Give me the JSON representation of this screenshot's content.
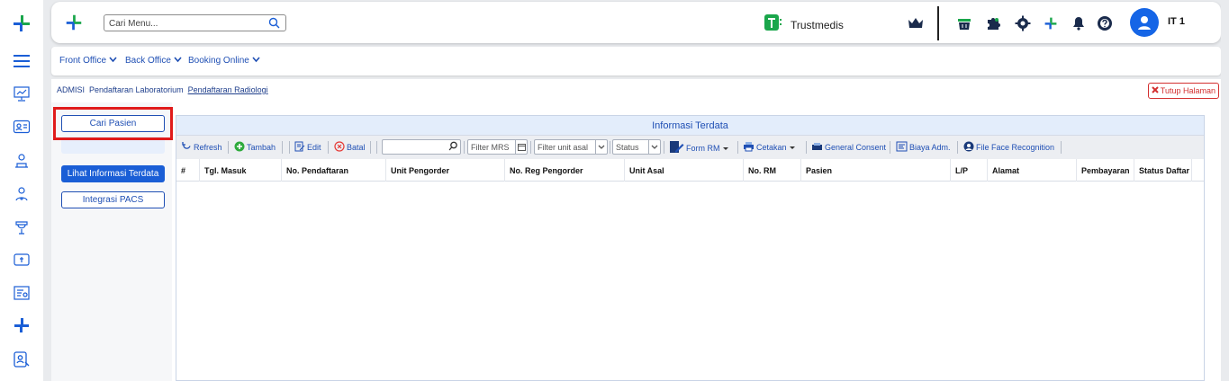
{
  "header": {
    "search_placeholder": "Cari Menu...",
    "brand_name": "Trustmedis",
    "user_name": "IT 1"
  },
  "menubar": {
    "items": [
      {
        "label": "Front Office"
      },
      {
        "label": "Back Office"
      },
      {
        "label": "Booking Online"
      }
    ]
  },
  "breadcrumb": {
    "items": [
      "ADMISI",
      "Pendaftaran Laboratorium",
      "Pendaftaran Radiologi"
    ]
  },
  "close_page_label": "Tutup Halaman",
  "left_panel": {
    "btn_search_patient": "Cari Pasien",
    "btn_view_registered": "Lihat Informasi Terdata",
    "btn_pacs": "Integrasi PACS"
  },
  "grid": {
    "title": "Informasi Terdata",
    "toolbar": {
      "refresh": "Refresh",
      "add": "Tambah",
      "edit": "Edit",
      "cancel": "Batal",
      "filter_mrs": "Filter MRS",
      "filter_unit": "Filter unit asal",
      "status": "Status",
      "form_rm": "Form RM",
      "print": "Cetakan",
      "consent": "General Consent",
      "admin_fee": "Biaya Adm.",
      "face": "File Face Recognition"
    },
    "columns": [
      "#",
      "Tgl. Masuk",
      "No. Pendaftaran",
      "Unit Pengorder",
      "No. Reg Pengorder",
      "Unit Asal",
      "No. RM",
      "Pasien",
      "L/P",
      "Alamat",
      "Pembayaran",
      "Status Daftar"
    ]
  },
  "colors": {
    "primary": "#1a5ed6",
    "link": "#1f4fb4",
    "brand_green": "#1aa64b",
    "danger": "#d32f2f"
  }
}
